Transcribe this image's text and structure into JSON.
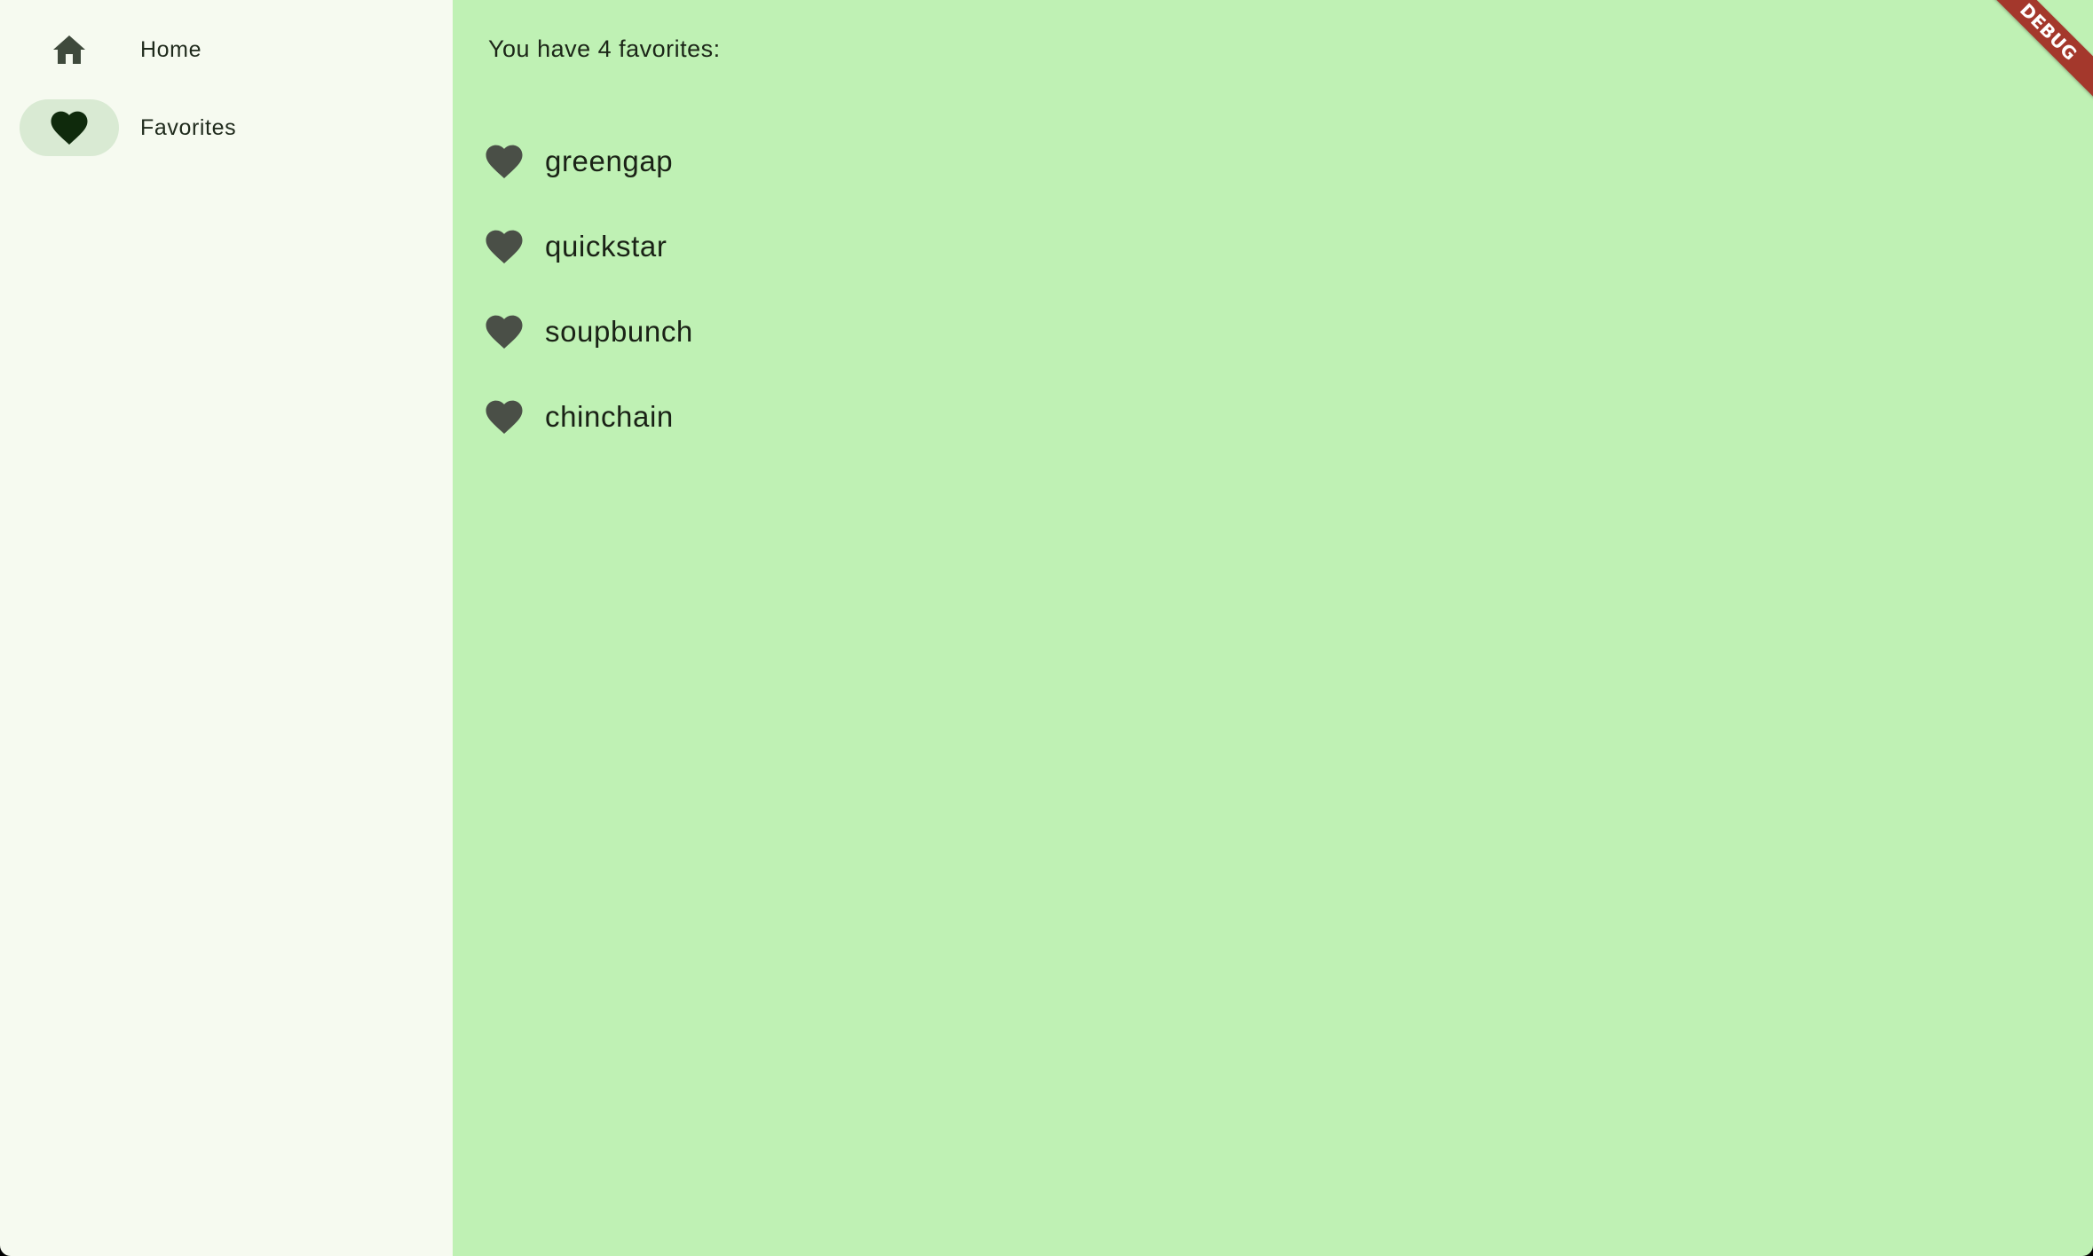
{
  "nav": {
    "items": [
      {
        "label": "Home",
        "icon": "home-icon",
        "selected": false
      },
      {
        "label": "Favorites",
        "icon": "heart-icon",
        "selected": true
      }
    ]
  },
  "main": {
    "header": "You have 4 favorites:",
    "favorites": [
      {
        "name": "greengap",
        "icon": "heart-icon"
      },
      {
        "name": "quickstar",
        "icon": "heart-icon"
      },
      {
        "name": "soupbunch",
        "icon": "heart-icon"
      },
      {
        "name": "chinchain",
        "icon": "heart-icon"
      }
    ]
  },
  "debug_banner": {
    "label": "DEBUG"
  },
  "colors": {
    "rail_background": "#f6faf0",
    "main_background": "#bff1b4",
    "selected_indicator": "#d9ead3",
    "icon_color": "#3f4a3c",
    "selected_icon_color": "#0f2a0c",
    "debug_ribbon": "#a4382c"
  }
}
